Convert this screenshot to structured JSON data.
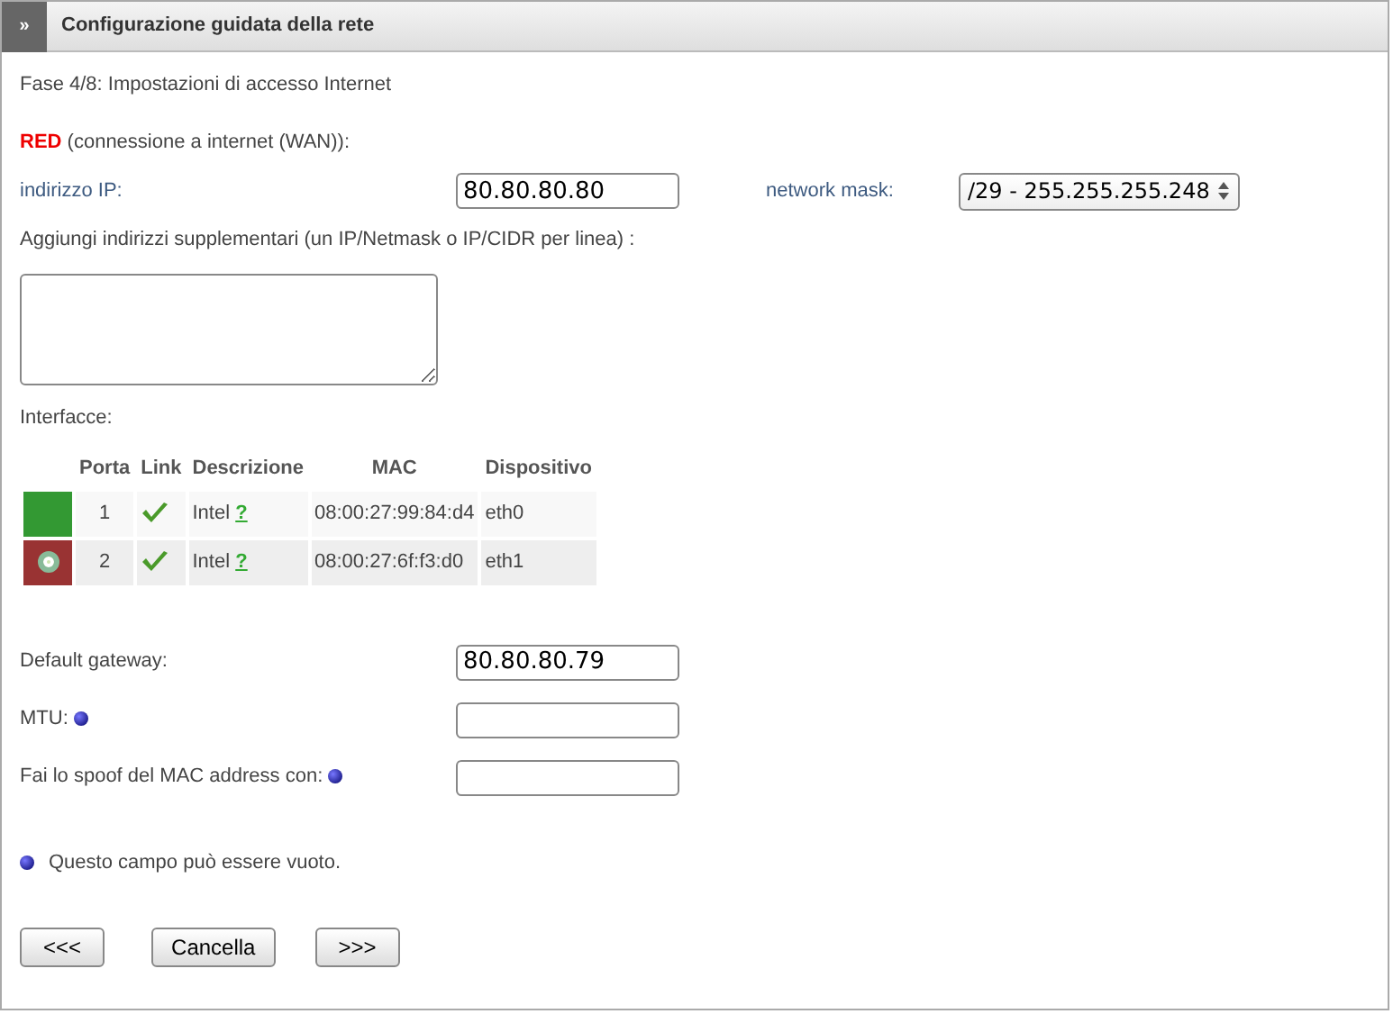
{
  "header": {
    "toggle": "»",
    "title": "Configurazione guidata della rete"
  },
  "step": "Fase 4/8: Impostazioni di accesso Internet",
  "zone": {
    "name": "RED",
    "description": "(connessione a internet (WAN)):"
  },
  "ip": {
    "label": "indirizzo IP:",
    "value": "80.80.80.80"
  },
  "netmask": {
    "label": "network mask:",
    "value": "/29 - 255.255.255.248"
  },
  "extra": {
    "label": "Aggiungi indirizzi supplementari (un IP/Netmask o IP/CIDR per linea) :"
  },
  "interfaces": {
    "label": "Interfacce:",
    "columns": [
      "Porta",
      "Link",
      "Descrizione",
      "MAC",
      "Dispositivo"
    ],
    "rows": [
      {
        "color": "#339933",
        "selected": false,
        "port": "1",
        "link": true,
        "description": "Intel",
        "help": "?",
        "mac": "08:00:27:99:84:d4",
        "device": "eth0"
      },
      {
        "color": "#993333",
        "selected": true,
        "port": "2",
        "link": true,
        "description": "Intel",
        "help": "?",
        "mac": "08:00:27:6f:f3:d0",
        "device": "eth1"
      }
    ]
  },
  "fields": [
    {
      "label": "Default gateway:",
      "value": "80.80.80.79",
      "optional": false
    },
    {
      "label": "MTU:",
      "optional": true
    },
    {
      "label": "Fai lo spoof del MAC address con:",
      "optional": true
    }
  ],
  "note": "Questo campo può essere vuoto.",
  "buttons": [
    "<<<",
    "Cancella",
    ">>>"
  ]
}
